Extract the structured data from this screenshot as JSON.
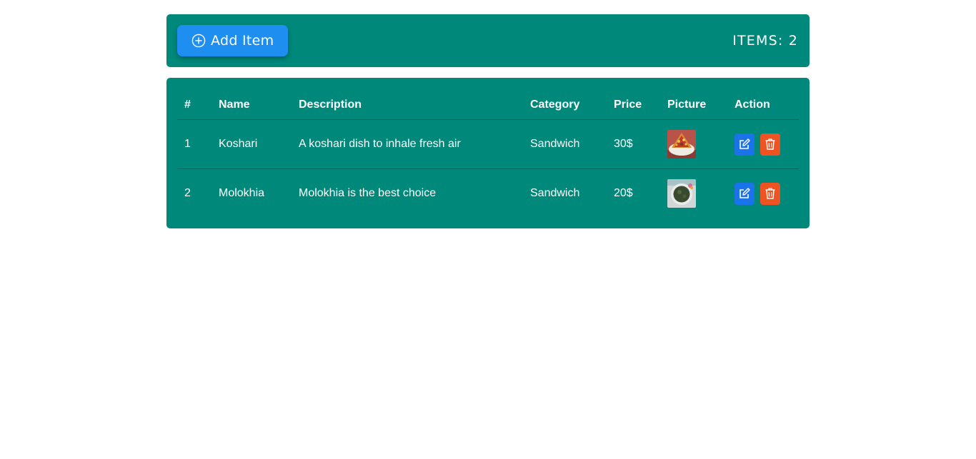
{
  "toolbar": {
    "add_label": "Add Item",
    "items_count": "ITEMS: 2"
  },
  "table": {
    "headers": [
      "#",
      "Name",
      "Description",
      "Category",
      "Price",
      "Picture",
      "Action"
    ],
    "rows": [
      {
        "index": "1",
        "name": "Koshari",
        "description": "A koshari dish to inhale fresh air",
        "category": "Sandwich",
        "price": "30$",
        "picture": "koshari-photo"
      },
      {
        "index": "2",
        "name": "Molokhia",
        "description": "Molokhia is the best choice",
        "category": "Sandwich",
        "price": "20$",
        "picture": "molokhia-photo"
      }
    ]
  },
  "icons": {
    "add": "plus-circle-icon",
    "edit": "edit-icon",
    "delete": "trash-icon"
  },
  "colors": {
    "panel": "#00897b",
    "add_button": "#1e8ef0",
    "edit_button": "#1a73e8",
    "delete_button": "#ef5322"
  }
}
